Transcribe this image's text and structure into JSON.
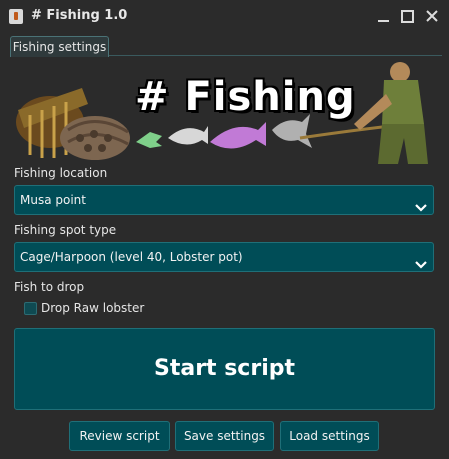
{
  "window": {
    "title": "# Fishing 1.0"
  },
  "tabs": [
    {
      "label": "Fishing settings"
    }
  ],
  "banner": {
    "title": "# Fishing"
  },
  "fishing_location": {
    "label": "Fishing location",
    "value": "Musa point"
  },
  "fishing_spot_type": {
    "label": "Fishing spot type",
    "value": "Cage/Harpoon (level 40, Lobster pot)"
  },
  "fish_to_drop": {
    "label": "Fish to drop",
    "options": [
      {
        "label": "Drop Raw lobster",
        "checked": false
      }
    ]
  },
  "actions": {
    "start": "Start script",
    "review": "Review script",
    "save": "Save settings",
    "load": "Load settings"
  },
  "colors": {
    "background": "#2b2b2b",
    "accent": "#004d57",
    "accent_border": "#1f6f78"
  }
}
